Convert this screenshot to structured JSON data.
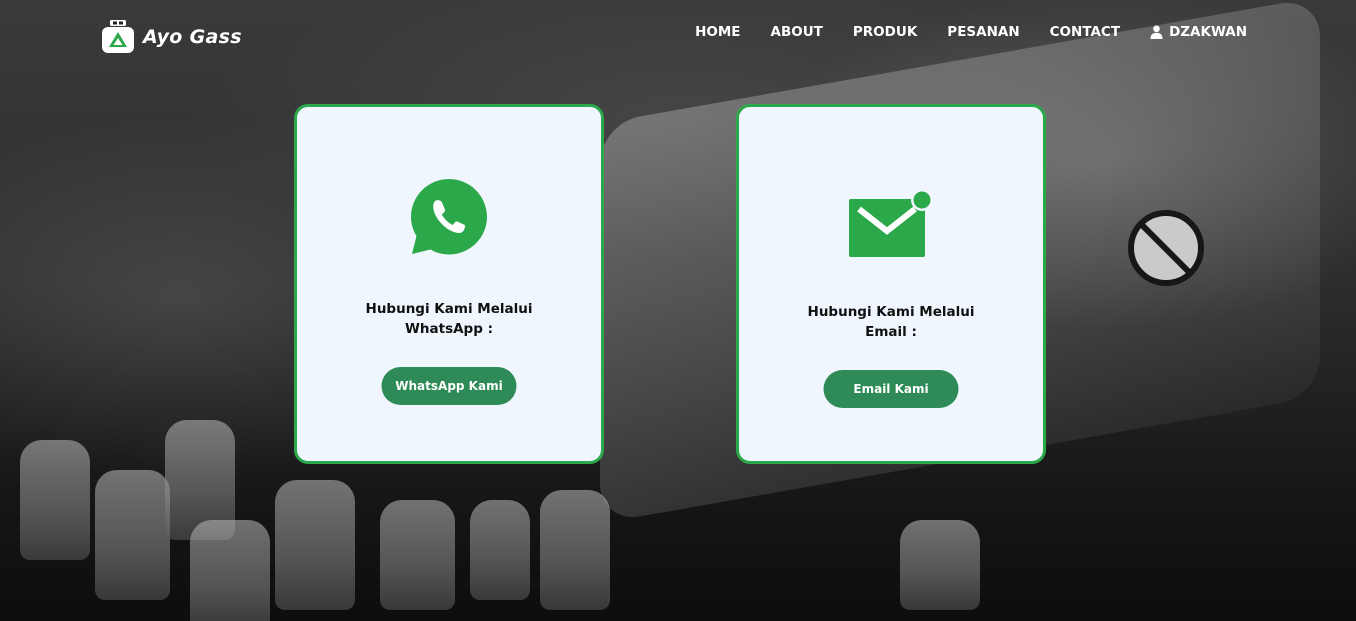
{
  "brand": {
    "name": "Ayo Gass",
    "logo_icon": "gas-cylinder-logo-icon"
  },
  "nav": {
    "items": [
      {
        "label": "HOME"
      },
      {
        "label": "ABOUT"
      },
      {
        "label": "PRODUK"
      },
      {
        "label": "PESANAN"
      },
      {
        "label": "CONTACT"
      }
    ],
    "user": {
      "icon": "user-icon",
      "label": "DZAKWAN"
    }
  },
  "contact": {
    "whatsapp": {
      "icon": "whatsapp-icon",
      "line1": "Hubungi Kami Melalui",
      "line2": "WhatsApp :",
      "button": "WhatsApp Kami"
    },
    "email": {
      "icon": "email-icon",
      "line1": "Hubungi Kami Melalui",
      "line2": "Email :",
      "button": "Email Kami"
    }
  },
  "colors": {
    "accent_green": "#2aa84a",
    "button_green": "#2e8b57",
    "card_bg": "#eff6fd"
  }
}
